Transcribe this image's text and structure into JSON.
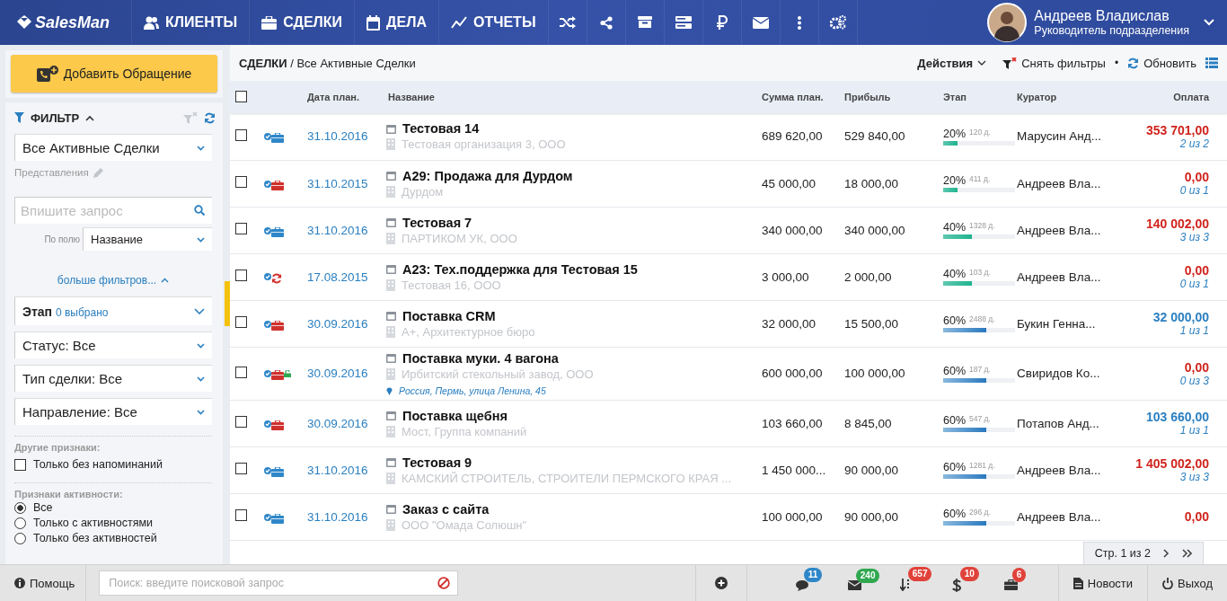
{
  "app": {
    "logo": "SalesMan"
  },
  "nav": [
    {
      "label": "КЛИЕНТЫ"
    },
    {
      "label": "СДЕЛКИ"
    },
    {
      "label": "ДЕЛА"
    },
    {
      "label": "ОТЧЕТЫ"
    }
  ],
  "user": {
    "name": "Андреев Владислав",
    "role": "Руководитель подразделения"
  },
  "sidebar": {
    "add_button": "Добавить Обращение",
    "filter": {
      "title": "ФИЛЬТР",
      "expanded": true
    },
    "view_select": "Все Активные Сделки",
    "views_label": "Представления",
    "search": {
      "placeholder": "Впишите запрос"
    },
    "field_label": "По полю",
    "field_select": "Название",
    "more_filters": "больше фильтров...",
    "stage": {
      "label": "Этап",
      "value": "0 выбрано"
    },
    "selects": [
      "Статус: Все",
      "Тип сделки: Все",
      "Направление: Все"
    ],
    "other_label": "Другие признаки:",
    "checkboxes": [
      {
        "label": "Только без напоминаний",
        "checked": false
      }
    ],
    "activity_label": "Признаки активности:",
    "radios": [
      {
        "label": "Все",
        "selected": true
      },
      {
        "label": "Только с активностями",
        "selected": false
      },
      {
        "label": "Только без активностей",
        "selected": false
      }
    ]
  },
  "breadcrumb": {
    "section": "СДЕЛКИ",
    "separator": "/",
    "page": "Все Активные Сделки"
  },
  "toolbar": {
    "actions": "Действия",
    "clear_filters": "Снять фильтры",
    "separator": "•",
    "refresh": "Обновить"
  },
  "table": {
    "columns": [
      "Дата план.",
      "Название",
      "Сумма план.",
      "Прибыль",
      "Этап",
      "Куратор",
      "Оплата"
    ],
    "all_checked": false,
    "rows": [
      {
        "selected": false,
        "kind": "deal",
        "color": "#2f87c9",
        "locked": false,
        "date": "31.10.2016",
        "title": "Тестовая 14",
        "company": "Тестовая организация 3, ООО",
        "sum": "689 620,00",
        "profit": "529 840,00",
        "stage": "20%",
        "level": 0.2,
        "days": "120 д.",
        "curator": "Марусин Анд...",
        "payment": "353 701,00",
        "paid": false,
        "payments_count": "2 из 2"
      },
      {
        "selected": false,
        "kind": "deal",
        "color": "#d0312d",
        "locked": false,
        "date": "31.10.2015",
        "title": "А29: Продажа для Дурдом",
        "company": "Дурдом",
        "sum": "45 000,00",
        "profit": "18 000,00",
        "stage": "20%",
        "level": 0.2,
        "days": "411 д.",
        "curator": "Андреев Вла...",
        "payment": "0,00",
        "paid": false,
        "payments_count": "0 из 1"
      },
      {
        "selected": false,
        "kind": "deal",
        "color": "#2f87c9",
        "locked": false,
        "date": "31.10.2016",
        "title": "Тестовая 7",
        "company": "ПАРТИКОМ УК, ООО",
        "sum": "340 000,00",
        "profit": "340 000,00",
        "stage": "40%",
        "level": 0.4,
        "days": "1328 д.",
        "curator": "Андреев Вла...",
        "payment": "140 002,00",
        "paid": false,
        "payments_count": "3 из 3"
      },
      {
        "selected": false,
        "kind": "recurring",
        "color": "#d0312d",
        "locked": false,
        "date": "17.08.2015",
        "title": "А23: Тех.поддержка для Тестовая 15",
        "company": "Тестовая 16, ООО",
        "sum": "3 000,00",
        "profit": "2 000,00",
        "stage": "40%",
        "level": 0.4,
        "days": "103 д.",
        "curator": "Андреев Вла...",
        "payment": "0,00",
        "paid": false,
        "payments_count": "0 из 1"
      },
      {
        "selected": false,
        "kind": "deal",
        "color": "#d0312d",
        "locked": false,
        "date": "30.09.2016",
        "title": "Поставка CRM",
        "company": "А+, Архитектурное бюро",
        "sum": "32 000,00",
        "profit": "15 500,00",
        "stage": "60%",
        "level": 0.6,
        "days": "2488 д.",
        "curator": "Букин Генна...",
        "payment": "32 000,00",
        "paid": true,
        "payments_count": "1 из 1"
      },
      {
        "selected": false,
        "kind": "deal",
        "color": "#d0312d",
        "locked": true,
        "date": "30.09.2016",
        "title": "Поставка муки. 4 вагона",
        "company": "Ирбитский стекольный завод, ООО",
        "address": "Россия, Пермь, улица Ленина, 45",
        "sum": "600 000,00",
        "profit": "100 000,00",
        "stage": "60%",
        "level": 0.6,
        "days": "187 д.",
        "curator": "Свиридов Ко...",
        "payment": "0,00",
        "paid": false,
        "payments_count": "0 из 3"
      },
      {
        "selected": false,
        "kind": "deal",
        "color": "#d0312d",
        "locked": false,
        "date": "30.09.2016",
        "title": "Поставка щебня",
        "company": "Мост, Группа компаний",
        "sum": "103 660,00",
        "profit": "8 845,00",
        "stage": "60%",
        "level": 0.6,
        "days": "547 д.",
        "curator": "Потапов Анд...",
        "payment": "103 660,00",
        "paid": true,
        "payments_count": "1 из 1"
      },
      {
        "selected": false,
        "kind": "deal",
        "color": "#2f87c9",
        "locked": false,
        "date": "31.10.2016",
        "title": "Тестовая 9",
        "company": "КАМСКИЙ СТРОИТЕЛЬ, СТРОИТЕЛИ ПЕРМСКОГО КРАЯ ...",
        "sum": "1 450 000...",
        "profit": "90 000,00",
        "stage": "60%",
        "level": 0.6,
        "days": "1281 д.",
        "curator": "Андреев Вла...",
        "payment": "1 405 002,00",
        "paid": false,
        "payments_count": "3 из 3"
      },
      {
        "selected": false,
        "kind": "deal",
        "color": "#2f87c9",
        "locked": false,
        "date": "31.10.2016",
        "title": "Заказ с сайта",
        "company": "ООО \"Омада Солюшн\"",
        "sum": "100 000,00",
        "profit": "90 000,00",
        "stage": "60%",
        "level": 0.6,
        "days": "296 д.",
        "curator": "Андреев Вла...",
        "payment": "0,00",
        "paid": false
      }
    ]
  },
  "pager": {
    "label": "Стр. 1 из 2"
  },
  "bottom": {
    "help": "Помощь",
    "search": {
      "placeholder": "Поиск: введите поисковой запрос"
    },
    "badges": [
      {
        "kind": "chat",
        "count": "11",
        "color": "#2e86c8"
      },
      {
        "kind": "mail",
        "count": "240",
        "color": "#2fa84f"
      },
      {
        "kind": "sort",
        "count": "657",
        "color": "#e0423a"
      },
      {
        "kind": "money",
        "count": "10",
        "color": "#e0423a"
      },
      {
        "kind": "briefcase",
        "count": "6",
        "color": "#e0423a"
      }
    ],
    "news": "Новости",
    "logout": "Выход"
  }
}
